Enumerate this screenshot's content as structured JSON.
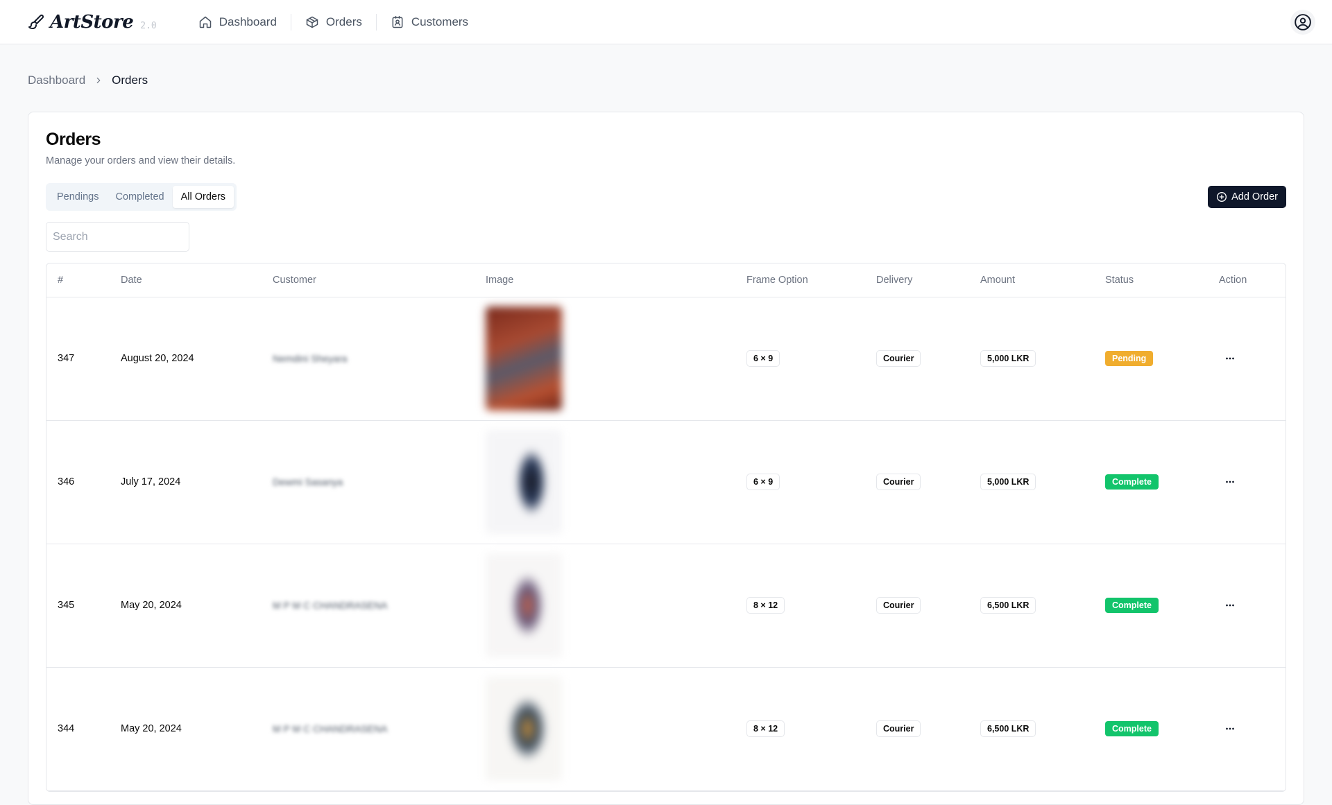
{
  "app": {
    "name": "ArtStore",
    "version": "2.0"
  },
  "nav": {
    "items": [
      {
        "label": "Dashboard",
        "icon": "home-icon"
      },
      {
        "label": "Orders",
        "icon": "package-icon"
      },
      {
        "label": "Customers",
        "icon": "contact-card-icon"
      }
    ]
  },
  "breadcrumb": {
    "items": [
      "Dashboard",
      "Orders"
    ]
  },
  "page": {
    "title": "Orders",
    "description": "Manage your orders and view their details."
  },
  "tabs": {
    "items": [
      "Pendings",
      "Completed",
      "All Orders"
    ],
    "active": "All Orders"
  },
  "toolbar": {
    "add_label": "Add Order"
  },
  "search": {
    "placeholder": "Search",
    "value": ""
  },
  "table": {
    "columns": [
      "#",
      "Date",
      "Customer",
      "Image",
      "Frame Option",
      "Delivery",
      "Amount",
      "Status",
      "Action"
    ],
    "rows": [
      {
        "id": "347",
        "date": "August 20, 2024",
        "customer": "Nemdini Sheyara",
        "frame": "6 × 9",
        "delivery": "Courier",
        "amount": "5,000 LKR",
        "status": "Pending"
      },
      {
        "id": "346",
        "date": "July 17, 2024",
        "customer": "Dewmi Sasanya",
        "frame": "6 × 9",
        "delivery": "Courier",
        "amount": "5,000 LKR",
        "status": "Complete"
      },
      {
        "id": "345",
        "date": "May 20, 2024",
        "customer": "M P M C CHANDRASENA",
        "frame": "8 × 12",
        "delivery": "Courier",
        "amount": "6,500 LKR",
        "status": "Complete"
      },
      {
        "id": "344",
        "date": "May 20, 2024",
        "customer": "M P M C CHANDRASENA",
        "frame": "8 × 12",
        "delivery": "Courier",
        "amount": "6,500 LKR",
        "status": "Complete"
      }
    ]
  },
  "colors": {
    "pending": "#f0ad2e",
    "complete": "#12c46b",
    "primary_button": "#0f172a"
  }
}
